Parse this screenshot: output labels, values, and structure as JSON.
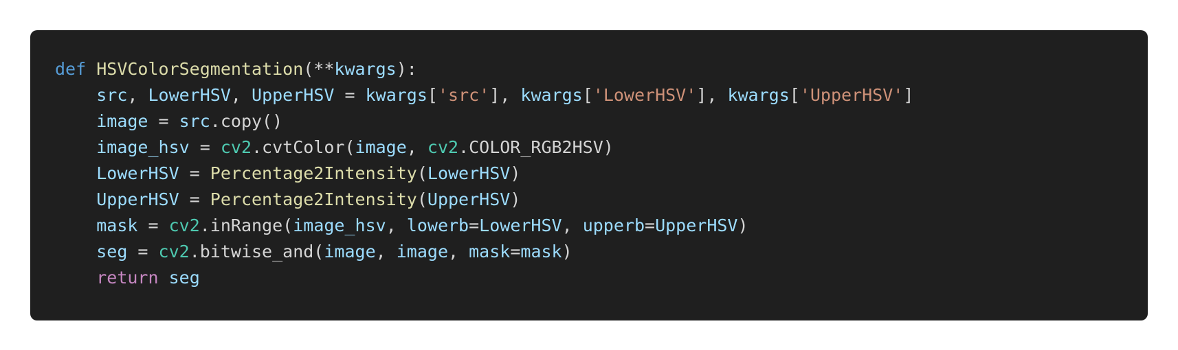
{
  "colors": {
    "background": "#1f1f1f",
    "page": "#ffffff",
    "keyword_def": "#569cd6",
    "keyword_flow": "#c586c0",
    "function": "#dcdcaa",
    "variable": "#9cdcfe",
    "string": "#ce9178",
    "module": "#4ec9b0",
    "default": "#d4d4d4"
  },
  "code": {
    "language": "python",
    "lines": [
      {
        "indent": 0,
        "tokens": [
          {
            "t": "kw-def",
            "v": "def"
          },
          {
            "t": "plain",
            "v": " "
          },
          {
            "t": "fn",
            "v": "HSVColorSegmentation"
          },
          {
            "t": "plain",
            "v": "(**"
          },
          {
            "t": "var",
            "v": "kwargs"
          },
          {
            "t": "plain",
            "v": "):"
          }
        ]
      },
      {
        "indent": 4,
        "tokens": [
          {
            "t": "var",
            "v": "src"
          },
          {
            "t": "plain",
            "v": ", "
          },
          {
            "t": "var",
            "v": "LowerHSV"
          },
          {
            "t": "plain",
            "v": ", "
          },
          {
            "t": "var",
            "v": "UpperHSV"
          },
          {
            "t": "plain",
            "v": " = "
          },
          {
            "t": "var",
            "v": "kwargs"
          },
          {
            "t": "plain",
            "v": "["
          },
          {
            "t": "str",
            "v": "'src'"
          },
          {
            "t": "plain",
            "v": "], "
          },
          {
            "t": "var",
            "v": "kwargs"
          },
          {
            "t": "plain",
            "v": "["
          },
          {
            "t": "str",
            "v": "'LowerHSV'"
          },
          {
            "t": "plain",
            "v": "], "
          },
          {
            "t": "var",
            "v": "kwargs"
          },
          {
            "t": "plain",
            "v": "["
          },
          {
            "t": "str",
            "v": "'UpperHSV'"
          },
          {
            "t": "plain",
            "v": "]"
          }
        ]
      },
      {
        "indent": 4,
        "tokens": [
          {
            "t": "var",
            "v": "image"
          },
          {
            "t": "plain",
            "v": " = "
          },
          {
            "t": "var",
            "v": "src"
          },
          {
            "t": "plain",
            "v": ".copy()"
          }
        ]
      },
      {
        "indent": 4,
        "tokens": [
          {
            "t": "var",
            "v": "image_hsv"
          },
          {
            "t": "plain",
            "v": " = "
          },
          {
            "t": "mod",
            "v": "cv2"
          },
          {
            "t": "plain",
            "v": ".cvtColor("
          },
          {
            "t": "var",
            "v": "image"
          },
          {
            "t": "plain",
            "v": ", "
          },
          {
            "t": "mod",
            "v": "cv2"
          },
          {
            "t": "plain",
            "v": ".COLOR_RGB2HSV)"
          }
        ]
      },
      {
        "indent": 4,
        "tokens": [
          {
            "t": "var",
            "v": "LowerHSV"
          },
          {
            "t": "plain",
            "v": " = "
          },
          {
            "t": "fn",
            "v": "Percentage2Intensity"
          },
          {
            "t": "plain",
            "v": "("
          },
          {
            "t": "var",
            "v": "LowerHSV"
          },
          {
            "t": "plain",
            "v": ")"
          }
        ]
      },
      {
        "indent": 4,
        "tokens": [
          {
            "t": "var",
            "v": "UpperHSV"
          },
          {
            "t": "plain",
            "v": " = "
          },
          {
            "t": "fn",
            "v": "Percentage2Intensity"
          },
          {
            "t": "plain",
            "v": "("
          },
          {
            "t": "var",
            "v": "UpperHSV"
          },
          {
            "t": "plain",
            "v": ")"
          }
        ]
      },
      {
        "indent": 4,
        "tokens": [
          {
            "t": "var",
            "v": "mask"
          },
          {
            "t": "plain",
            "v": " = "
          },
          {
            "t": "mod",
            "v": "cv2"
          },
          {
            "t": "plain",
            "v": ".inRange("
          },
          {
            "t": "var",
            "v": "image_hsv"
          },
          {
            "t": "plain",
            "v": ", "
          },
          {
            "t": "var",
            "v": "lowerb"
          },
          {
            "t": "plain",
            "v": "="
          },
          {
            "t": "var",
            "v": "LowerHSV"
          },
          {
            "t": "plain",
            "v": ", "
          },
          {
            "t": "var",
            "v": "upperb"
          },
          {
            "t": "plain",
            "v": "="
          },
          {
            "t": "var",
            "v": "UpperHSV"
          },
          {
            "t": "plain",
            "v": ")"
          }
        ]
      },
      {
        "indent": 4,
        "tokens": [
          {
            "t": "var",
            "v": "seg"
          },
          {
            "t": "plain",
            "v": " = "
          },
          {
            "t": "mod",
            "v": "cv2"
          },
          {
            "t": "plain",
            "v": ".bitwise_and("
          },
          {
            "t": "var",
            "v": "image"
          },
          {
            "t": "plain",
            "v": ", "
          },
          {
            "t": "var",
            "v": "image"
          },
          {
            "t": "plain",
            "v": ", "
          },
          {
            "t": "var",
            "v": "mask"
          },
          {
            "t": "plain",
            "v": "="
          },
          {
            "t": "var",
            "v": "mask"
          },
          {
            "t": "plain",
            "v": ")"
          }
        ]
      },
      {
        "indent": 4,
        "tokens": [
          {
            "t": "kw-flow",
            "v": "return"
          },
          {
            "t": "plain",
            "v": " "
          },
          {
            "t": "var",
            "v": "seg"
          }
        ]
      }
    ]
  }
}
